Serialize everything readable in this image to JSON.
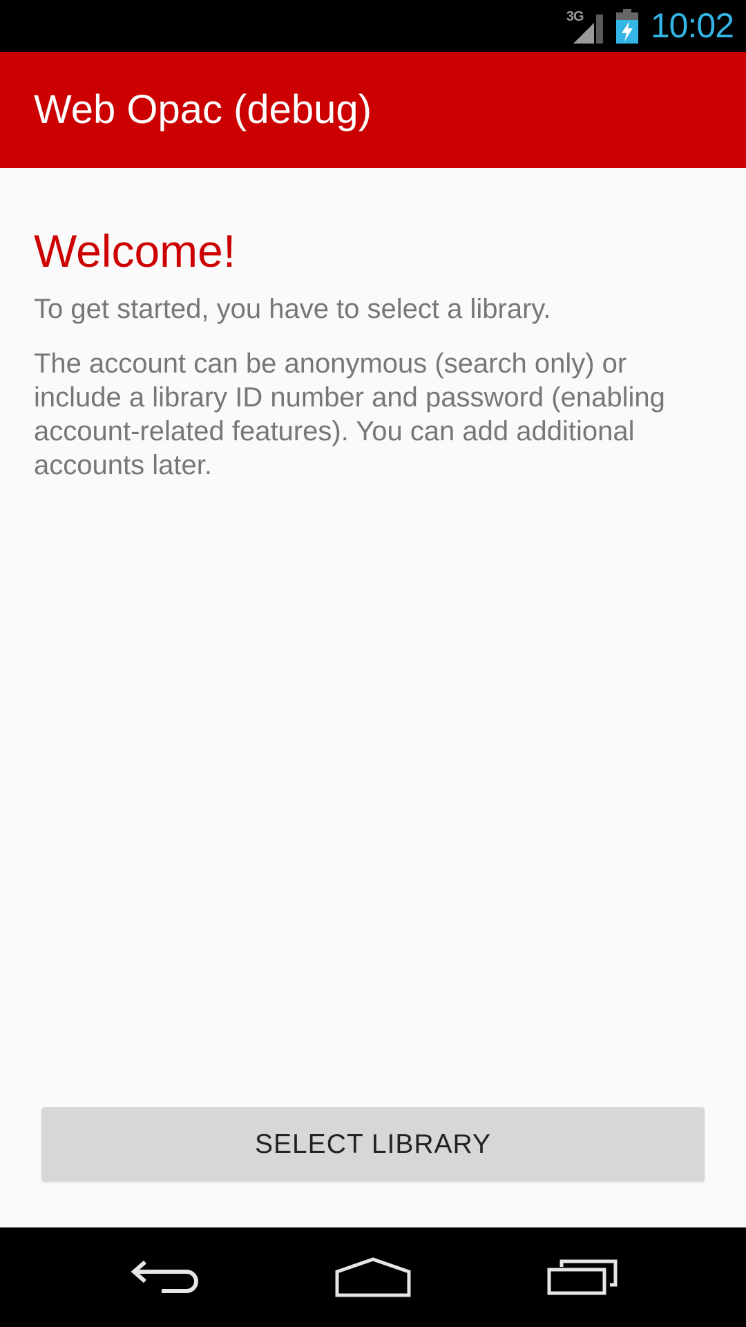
{
  "status_bar": {
    "network_type": "3G",
    "time": "10:02",
    "icons": [
      "signal-icon",
      "battery-charging-icon"
    ],
    "clock_color": "#33b5e5"
  },
  "action_bar": {
    "title": "Web Opac (debug)",
    "color": "#cc0000"
  },
  "main": {
    "heading": "Welcome!",
    "paragraph_1": "To get started, you have to select a library.",
    "paragraph_2": "The account can be anonymous (search only) or include a library ID number and password (enabling account-related features). You can add additional accounts later."
  },
  "select_button": {
    "label": "SELECT LIBRARY"
  },
  "nav_bar": {
    "icons": [
      "back-icon",
      "home-icon",
      "recent-apps-icon"
    ]
  }
}
